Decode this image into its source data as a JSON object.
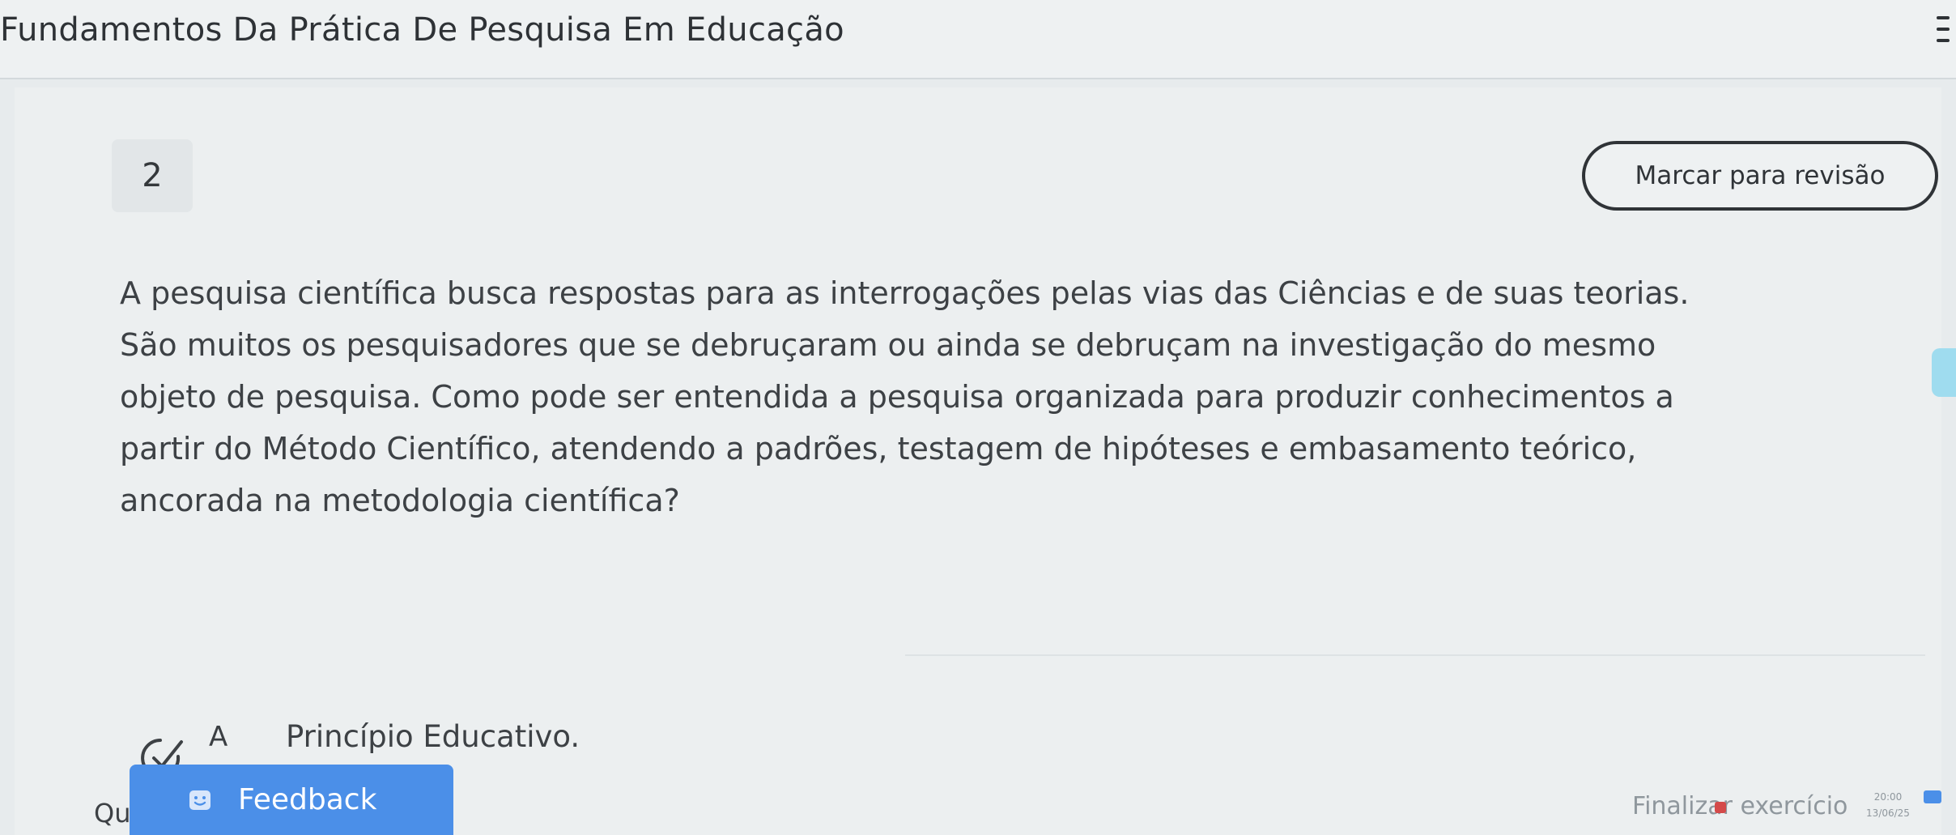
{
  "header": {
    "title": "Fundamentos Da Prática De Pesquisa Em Educação",
    "menu_icon": "hamburger-menu-icon"
  },
  "question": {
    "number": "2",
    "mark_review_label": "Marcar para revisão",
    "lines": [
      "A pesquisa científica busca respostas para as interrogações pelas vias das Ciências e de suas teorias.",
      "São muitos os pesquisadores que se debruçaram ou ainda se debruçam na investigação do mesmo",
      "objeto de pesquisa. Como pode ser entendida a pesquisa organizada para produzir conhecimentos a",
      "partir do Método Científico, atendendo a padrões, testagem de hipóteses e embasamento teórico,",
      "ancorada na metodologia científica?"
    ]
  },
  "options": [
    {
      "letter": "A",
      "text": "Princípio Educativo."
    }
  ],
  "footer": {
    "finish_label": "Finalizar exercício",
    "qu_text": "Qu",
    "feedback_label": "Feedback",
    "feedback_icon": "smiley-icon",
    "check_icon": "checkmark-icon"
  },
  "taskbar": {
    "time": "20:00",
    "date": "13/06/25"
  },
  "colors": {
    "accent": "#4b8fe8",
    "background": "#eceff0",
    "text": "#3d4145"
  }
}
